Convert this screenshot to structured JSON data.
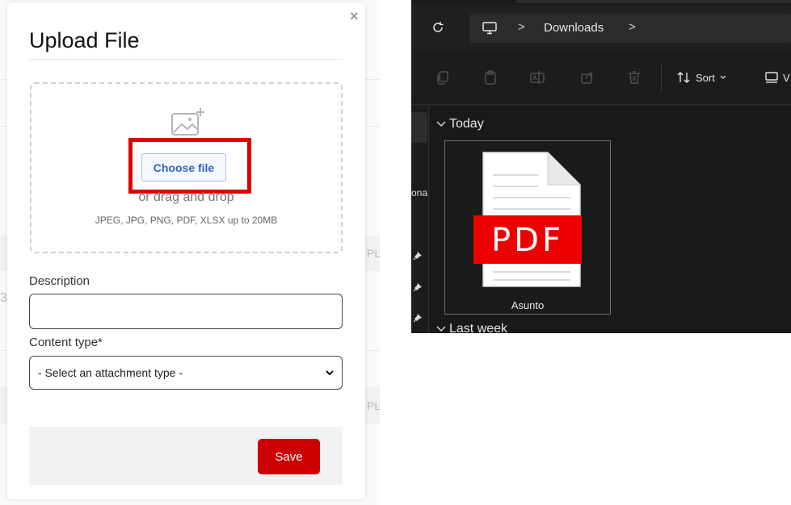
{
  "upload_modal": {
    "title": "Upload File",
    "close_glyph": "×",
    "choose_file_label": "Choose file",
    "drag_drop_text": "or drag and drop",
    "file_types_hint": "JPEG, JPG, PNG, PDF, XLSX up to 20MB",
    "description_label": "Description",
    "description_value": "",
    "content_type_label": "Content type*",
    "content_type_selected": "- Select an attachment type -",
    "save_label": "Save",
    "highlight_color": "#e00000",
    "save_color": "#cc0000"
  },
  "background_page": {
    "fragments": [
      "PL",
      "3",
      "PL"
    ]
  },
  "file_explorer": {
    "breadcrumb": {
      "separator": ">",
      "items": [
        "Downloads"
      ]
    },
    "toolbar": {
      "sort_label": "Sort",
      "view_label": "V"
    },
    "nav_fragment": "ona",
    "groups": [
      {
        "label": "Today"
      },
      {
        "label": "Last week"
      }
    ],
    "files": [
      {
        "name": "Asunto",
        "badge": "PDF",
        "icon": "pdf-file-icon"
      }
    ]
  }
}
